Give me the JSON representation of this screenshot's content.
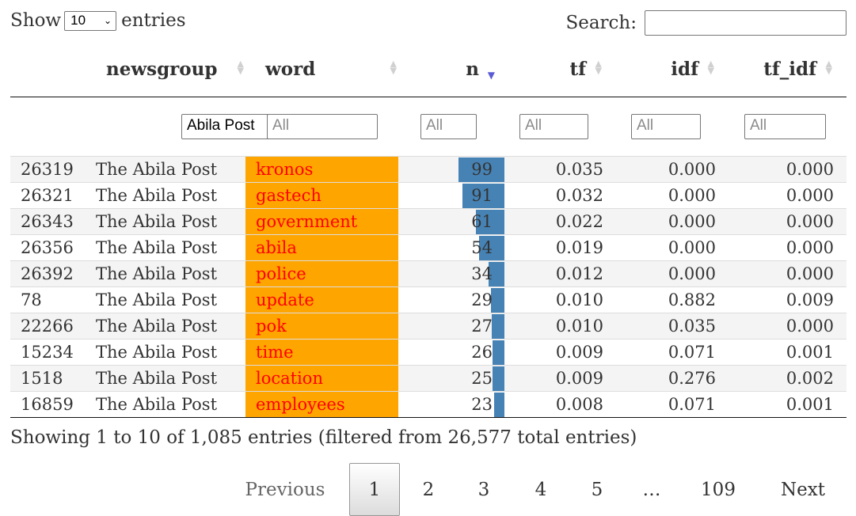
{
  "length_menu": {
    "show_label": "Show",
    "selected": "10",
    "entries_label": "entries"
  },
  "search": {
    "label": "Search:",
    "value": ""
  },
  "columns": [
    "newsgroup",
    "word",
    "n",
    "tf",
    "idf",
    "tf_idf"
  ],
  "filters": {
    "newsgroup": "Abila Post",
    "word": "All",
    "n": "All",
    "tf": "All",
    "idf": "All",
    "tf_idf": "All"
  },
  "rows": [
    {
      "id": "26319",
      "newsgroup": "The Abila Post",
      "word": "kronos",
      "n": "99",
      "tf": "0.035",
      "idf": "0.000",
      "tf_idf": "0.000"
    },
    {
      "id": "26321",
      "newsgroup": "The Abila Post",
      "word": "gastech",
      "n": "91",
      "tf": "0.032",
      "idf": "0.000",
      "tf_idf": "0.000"
    },
    {
      "id": "26343",
      "newsgroup": "The Abila Post",
      "word": "government",
      "n": "61",
      "tf": "0.022",
      "idf": "0.000",
      "tf_idf": "0.000"
    },
    {
      "id": "26356",
      "newsgroup": "The Abila Post",
      "word": "abila",
      "n": "54",
      "tf": "0.019",
      "idf": "0.000",
      "tf_idf": "0.000"
    },
    {
      "id": "26392",
      "newsgroup": "The Abila Post",
      "word": "police",
      "n": "34",
      "tf": "0.012",
      "idf": "0.000",
      "tf_idf": "0.000"
    },
    {
      "id": "78",
      "newsgroup": "The Abila Post",
      "word": "update",
      "n": "29",
      "tf": "0.010",
      "idf": "0.882",
      "tf_idf": "0.009"
    },
    {
      "id": "22266",
      "newsgroup": "The Abila Post",
      "word": "pok",
      "n": "27",
      "tf": "0.010",
      "idf": "0.035",
      "tf_idf": "0.000"
    },
    {
      "id": "15234",
      "newsgroup": "The Abila Post",
      "word": "time",
      "n": "26",
      "tf": "0.009",
      "idf": "0.071",
      "tf_idf": "0.001"
    },
    {
      "id": "1518",
      "newsgroup": "The Abila Post",
      "word": "location",
      "n": "25",
      "tf": "0.009",
      "idf": "0.276",
      "tf_idf": "0.002"
    },
    {
      "id": "16859",
      "newsgroup": "The Abila Post",
      "word": "employees",
      "n": "23",
      "tf": "0.008",
      "idf": "0.071",
      "tf_idf": "0.001"
    }
  ],
  "n_max": 99,
  "colors": {
    "word_bg": "#ffa500",
    "word_text": "#ff0000",
    "n_bar": "#4682b4"
  },
  "info": "Showing 1 to 10 of 1,085 entries (filtered from 26,577 total entries)",
  "pagination": {
    "previous": "Previous",
    "pages": [
      "1",
      "2",
      "3",
      "4",
      "5",
      "…",
      "109"
    ],
    "current": "1",
    "next": "Next"
  }
}
